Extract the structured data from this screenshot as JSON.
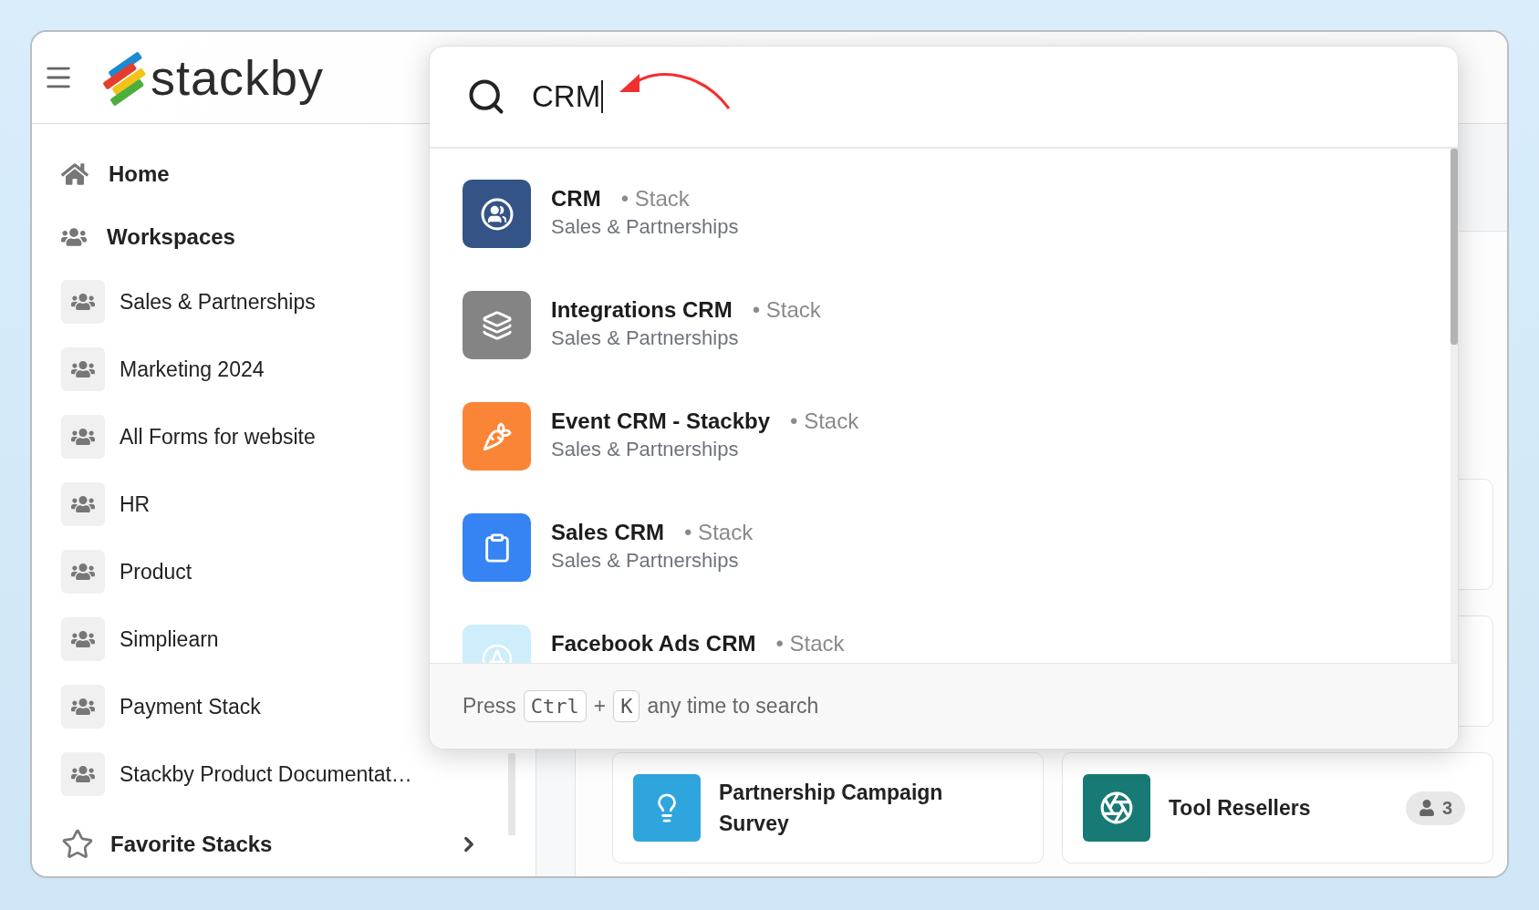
{
  "app": {
    "logo": "stackby"
  },
  "sidebar": {
    "items": [
      {
        "kind": "home",
        "label": "Home"
      },
      {
        "kind": "workspaces",
        "label": "Workspaces"
      },
      {
        "kind": "workspace",
        "label": "Sales & Partnerships"
      },
      {
        "kind": "workspace",
        "label": "Marketing 2024"
      },
      {
        "kind": "workspace",
        "label": "All Forms for website"
      },
      {
        "kind": "workspace",
        "label": "HR"
      },
      {
        "kind": "workspace",
        "label": "Product"
      },
      {
        "kind": "workspace",
        "label": "Simpliearn"
      },
      {
        "kind": "workspace",
        "label": "Payment Stack"
      },
      {
        "kind": "workspace",
        "label": "Stackby Product Documentat…"
      }
    ],
    "favorites": {
      "label": "Favorite Stacks"
    }
  },
  "stacks": [
    {
      "title": "Partnership Campaign Survey",
      "kind": "bulb",
      "color": "#2fa5de"
    },
    {
      "title": "Tool Resellers",
      "kind": "aperture",
      "color": "#177a75",
      "members": "3"
    }
  ],
  "search": {
    "query": "CRM",
    "results": [
      {
        "title": "CRM",
        "type": "• Stack",
        "workspace": "Sales & Partnerships",
        "kind": "people",
        "color": "#345487"
      },
      {
        "title": "Integrations CRM",
        "type": "• Stack",
        "workspace": "Sales & Partnerships",
        "kind": "layers",
        "color": "#848484"
      },
      {
        "title": "Event CRM - Stackby",
        "type": "• Stack",
        "workspace": "Sales & Partnerships",
        "kind": "carrot",
        "color": "#fb8537"
      },
      {
        "title": "Sales CRM",
        "type": "• Stack",
        "workspace": "Sales & Partnerships",
        "kind": "clipboard",
        "color": "#3683f3"
      },
      {
        "title": "Facebook Ads CRM",
        "type": "• Stack",
        "kind": "appstore",
        "color": "#cdeefa"
      }
    ],
    "hint": {
      "prefix": "Press",
      "keys": [
        "Ctrl",
        "K"
      ],
      "joiner": "+",
      "suffix": "any time to search"
    }
  }
}
